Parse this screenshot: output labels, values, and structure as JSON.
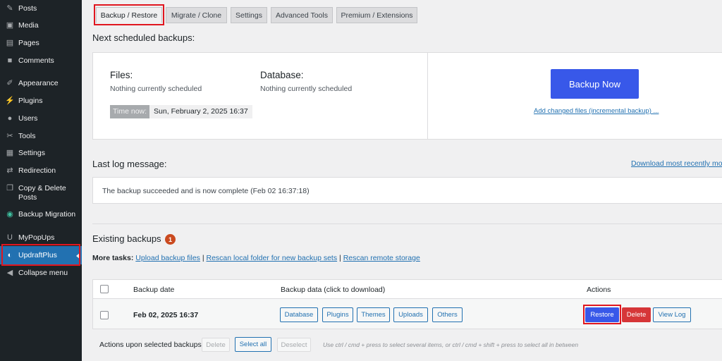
{
  "sidebar": {
    "items": [
      {
        "label": "Posts",
        "icon": "pin-icon"
      },
      {
        "label": "Media",
        "icon": "media-icon"
      },
      {
        "label": "Pages",
        "icon": "pages-icon"
      },
      {
        "label": "Comments",
        "icon": "comments-icon"
      },
      {
        "label": "Appearance",
        "icon": "brush-icon"
      },
      {
        "label": "Plugins",
        "icon": "plug-icon"
      },
      {
        "label": "Users",
        "icon": "user-icon"
      },
      {
        "label": "Tools",
        "icon": "wrench-icon"
      },
      {
        "label": "Settings",
        "icon": "settings-icon"
      },
      {
        "label": "Redirection",
        "icon": "redirect-icon"
      },
      {
        "label": "Copy & Delete Posts",
        "icon": "copy-icon"
      },
      {
        "label": "Backup Migration",
        "icon": "backup-icon"
      },
      {
        "label": "MyPopUps",
        "icon": "popup-icon"
      },
      {
        "label": "UpdraftPlus",
        "icon": "updraft-icon"
      },
      {
        "label": "Collapse menu",
        "icon": "collapse-icon"
      }
    ]
  },
  "tabs": [
    "Backup / Restore",
    "Migrate / Clone",
    "Settings",
    "Advanced Tools",
    "Premium / Extensions"
  ],
  "scheduled": {
    "heading": "Next scheduled backups:",
    "files_label": "Files:",
    "files_value": "Nothing currently scheduled",
    "db_label": "Database:",
    "db_value": "Nothing currently scheduled",
    "time_label": "Time now:",
    "time_value": "Sun, February 2, 2025 16:37",
    "backup_now": "Backup Now",
    "incremental_link": "Add changed files (incremental backup) ..."
  },
  "log": {
    "heading": "Last log message:",
    "download_link": "Download most recently mod",
    "message": "The backup succeeded and is now complete (Feb 02 16:37:18)"
  },
  "existing": {
    "heading": "Existing backups",
    "count": "1",
    "more_tasks_label": "More tasks:",
    "upload_link": "Upload backup files",
    "rescan_local_link": "Rescan local folder for new backup sets",
    "rescan_remote_link": "Rescan remote storage",
    "sep": "|",
    "col_date": "Backup date",
    "col_data": "Backup data (click to download)",
    "col_actions": "Actions",
    "row": {
      "date": "Feb 02, 2025 16:37",
      "data_buttons": [
        "Database",
        "Plugins",
        "Themes",
        "Uploads",
        "Others"
      ],
      "restore": "Restore",
      "delete": "Delete",
      "view_log": "View Log"
    },
    "bulk_label": "Actions upon selected backups",
    "bulk_delete": "Delete",
    "select_all": "Select all",
    "deselect": "Deselect",
    "hint": "Use ctrl / cmd + press to select several items, or ctrl / cmd + shift + press to select all in between"
  },
  "colors": {
    "accent": "#3858e9",
    "highlight": "#e0161f",
    "delete": "#d63638"
  }
}
